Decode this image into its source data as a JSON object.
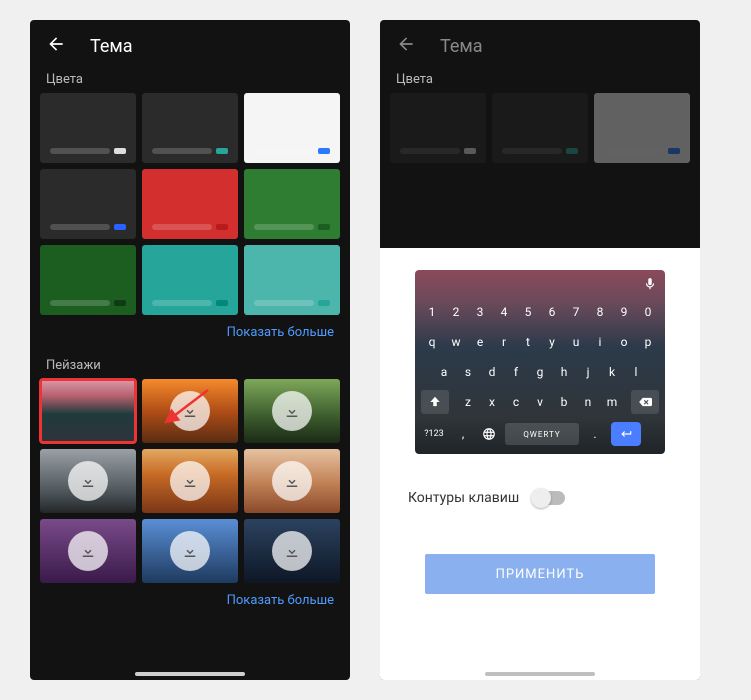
{
  "header": {
    "title": "Тема"
  },
  "sections": {
    "colors_label": "Цвета",
    "landscapes_label": "Пейзажи",
    "show_more": "Показать больше"
  },
  "color_tiles": [
    {
      "bg": "#2b2b2b",
      "accent": "#dddddd"
    },
    {
      "bg": "#2b2b2b",
      "accent": "#26a69a"
    },
    {
      "bg": "#f5f5f5",
      "accent": "#2979ff"
    },
    {
      "bg": "#2b2b2b",
      "accent": "#2962ff"
    },
    {
      "bg": "#d32f2f",
      "accent": "#b71c1c"
    },
    {
      "bg": "#2e7d32",
      "accent": "#1b5e20"
    },
    {
      "bg": "#1b5e20",
      "accent": "#0f3b12"
    },
    {
      "bg": "#26a69a",
      "accent": "#00897b"
    },
    {
      "bg": "#4db6ac",
      "accent": "#26a69a"
    }
  ],
  "landscape_tiles": [
    {
      "bgclass": "bg-sunset",
      "selected": true,
      "downloadable": false
    },
    {
      "bgclass": "bg-orange",
      "selected": false,
      "downloadable": true
    },
    {
      "bgclass": "bg-green",
      "selected": false,
      "downloadable": true
    },
    {
      "bgclass": "bg-grey",
      "selected": false,
      "downloadable": true
    },
    {
      "bgclass": "bg-red",
      "selected": false,
      "downloadable": true
    },
    {
      "bgclass": "bg-canyon",
      "selected": false,
      "downloadable": true
    },
    {
      "bgclass": "bg-purple",
      "selected": false,
      "downloadable": true
    },
    {
      "bgclass": "bg-sky",
      "selected": false,
      "downloadable": true
    },
    {
      "bgclass": "bg-night",
      "selected": false,
      "downloadable": true
    }
  ],
  "modal": {
    "toggle_label": "Контуры клавиш",
    "toggled": false,
    "apply_label": "ПРИМЕНИТЬ",
    "keyboard": {
      "row1": [
        "1",
        "2",
        "3",
        "4",
        "5",
        "6",
        "7",
        "8",
        "9",
        "0"
      ],
      "row2": [
        "q",
        "w",
        "e",
        "r",
        "t",
        "y",
        "u",
        "i",
        "o",
        "p"
      ],
      "row3": [
        "a",
        "s",
        "d",
        "f",
        "g",
        "h",
        "j",
        "k",
        "l"
      ],
      "row4": [
        "z",
        "x",
        "c",
        "v",
        "b",
        "n",
        "m"
      ],
      "symkey": "?123",
      "comma": ",",
      "space_label": "QWERTY",
      "period": "."
    }
  }
}
